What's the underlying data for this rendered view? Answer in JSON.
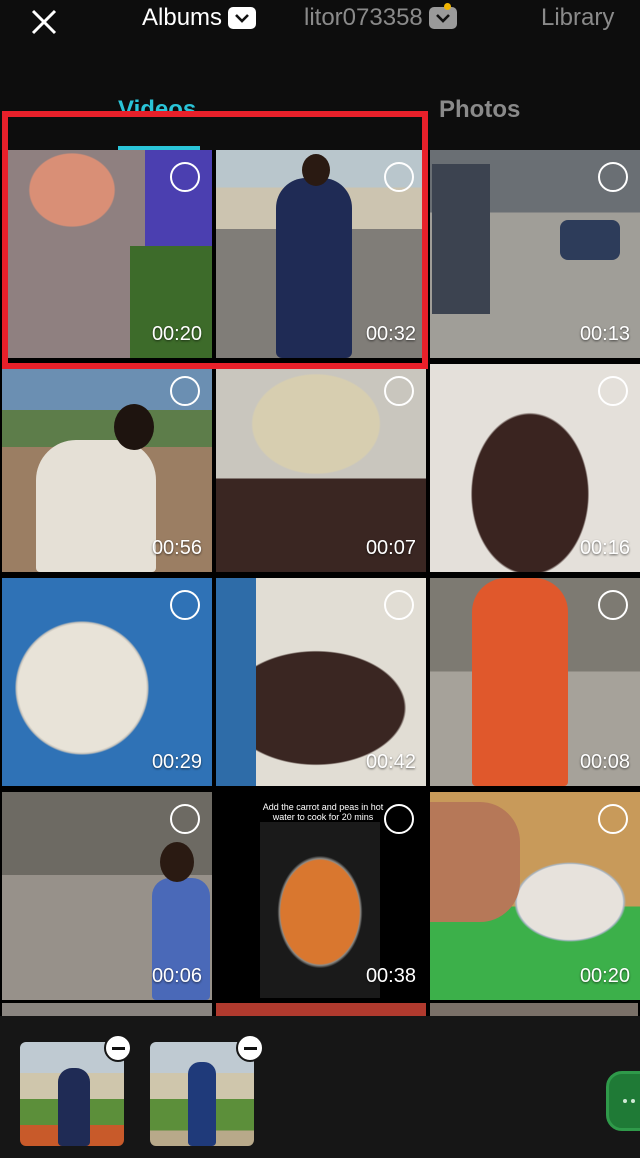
{
  "header": {
    "album_title": "Albums",
    "account_name": "litor073358",
    "library_label": "Library",
    "icons": {
      "close": "close-icon",
      "album_dropdown": "chevron-down-icon",
      "account_dropdown": "chevron-down-icon"
    }
  },
  "tabs": [
    {
      "label": "Videos",
      "active": true
    },
    {
      "label": "Photos",
      "active": false
    }
  ],
  "grid": {
    "items": [
      {
        "duration": "00:20"
      },
      {
        "duration": "00:32"
      },
      {
        "duration": "00:13"
      },
      {
        "duration": "00:56"
      },
      {
        "duration": "00:07"
      },
      {
        "duration": "00:16"
      },
      {
        "duration": "00:29"
      },
      {
        "duration": "00:42"
      },
      {
        "duration": "00:08"
      },
      {
        "duration": "00:06"
      },
      {
        "duration": "00:38"
      },
      {
        "duration": "00:20"
      }
    ],
    "overlay_caption": "Add the carrot and peas in hot water to cook for 20 mins"
  },
  "tray": {
    "selected_count": 2,
    "icons": {
      "remove": "minus-icon",
      "next": "more-dots-icon"
    }
  },
  "colors": {
    "accent": "#2ac4d8",
    "highlight": "#e8202a",
    "next_button": "#1f7a36",
    "notification": "#f0b400"
  }
}
